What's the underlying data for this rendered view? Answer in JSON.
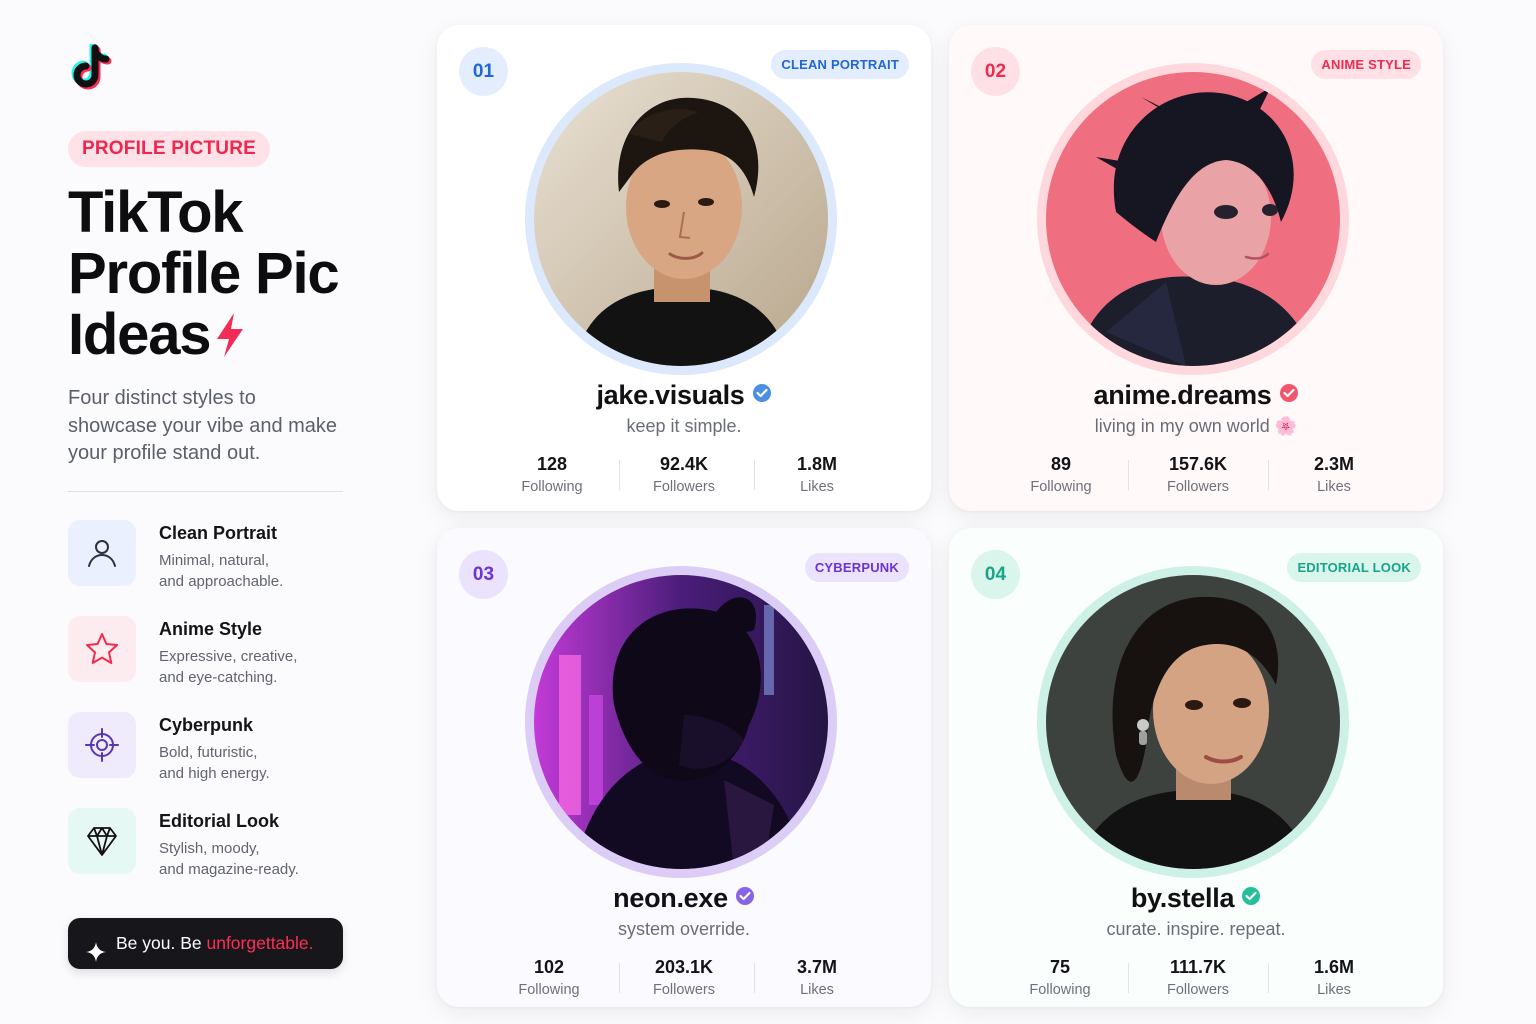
{
  "sidebar": {
    "logo_icon": "tiktok-logo-icon",
    "pill": "PROFILE PICTURE",
    "headline": [
      "TikTok",
      "Profile Pic",
      "Ideas"
    ],
    "description": "Four distinct styles to showcase your vibe and make your profile stand out.",
    "features": [
      {
        "icon": "user-icon",
        "title": "Clean Portrait",
        "desc": [
          "Minimal, natural,",
          "and approachable."
        ],
        "color": "#4a5bd6",
        "bg": "#eaf0fd"
      },
      {
        "icon": "star-icon",
        "title": "Anime Style",
        "desc": [
          "Expressive, creative,",
          "and eye-catching."
        ],
        "color": "#f0264f",
        "bg": "#fdecef"
      },
      {
        "icon": "crosshair-icon",
        "title": "Cyberpunk",
        "desc": [
          "Bold, futuristic,",
          "and high energy."
        ],
        "color": "#6a3fd6",
        "bg": "#efebfd"
      },
      {
        "icon": "diamond-icon",
        "title": "Editorial Look",
        "desc": [
          "Stylish, moody,",
          "and magazine-ready."
        ],
        "color": "#111114",
        "bg": "#e5f8f3"
      }
    ],
    "cta": {
      "text": "Be you. Be ",
      "accent": "unforgettable."
    }
  },
  "cards": [
    {
      "number": "01",
      "tag": "CLEAN PORTRAIT",
      "username": "jake.visuals",
      "bio": "keep it simple.",
      "stats": [
        {
          "value": "128",
          "label": "Following"
        },
        {
          "value": "92.4K",
          "label": "Followers"
        },
        {
          "value": "1.8M",
          "label": "Likes"
        }
      ],
      "accent": "#1f66d6",
      "ring": "#dce8fb",
      "card_bg": "#ffffff",
      "num_bg": "#e4edfd",
      "tag_bg": "#e4edfd",
      "verified_color": "#4a90e2"
    },
    {
      "number": "02",
      "tag": "ANIME STYLE",
      "username": "anime.dreams",
      "bio": "living in my own world 🌸",
      "stats": [
        {
          "value": "89",
          "label": "Following"
        },
        {
          "value": "157.6K",
          "label": "Followers"
        },
        {
          "value": "2.3M",
          "label": "Likes"
        }
      ],
      "accent": "#ef2b4f",
      "ring": "#ffd8de",
      "card_bg": "#fff9fa",
      "num_bg": "#ffe0e6",
      "tag_bg": "#ffe0e6",
      "verified_color": "#f0566c"
    },
    {
      "number": "03",
      "tag": "CYBERPUNK",
      "username": "neon.exe",
      "bio": "system override.",
      "stats": [
        {
          "value": "102",
          "label": "Following"
        },
        {
          "value": "203.1K",
          "label": "Followers"
        },
        {
          "value": "3.7M",
          "label": "Likes"
        }
      ],
      "accent": "#6a34d0",
      "ring": "#dccdf7",
      "card_bg": "#fbfaff",
      "num_bg": "#ebe2fd",
      "tag_bg": "#ebe2fd",
      "verified_color": "#8a64e6"
    },
    {
      "number": "04",
      "tag": "EDITORIAL LOOK",
      "username": "by.stella",
      "bio": "curate. inspire. repeat.",
      "stats": [
        {
          "value": "75",
          "label": "Following"
        },
        {
          "value": "111.7K",
          "label": "Followers"
        },
        {
          "value": "1.6M",
          "label": "Likes"
        }
      ],
      "accent": "#18a586",
      "ring": "#cdf1e6",
      "card_bg": "#fafefd",
      "num_bg": "#d9f5ec",
      "tag_bg": "#d9f5ec",
      "verified_color": "#25c09a"
    }
  ]
}
